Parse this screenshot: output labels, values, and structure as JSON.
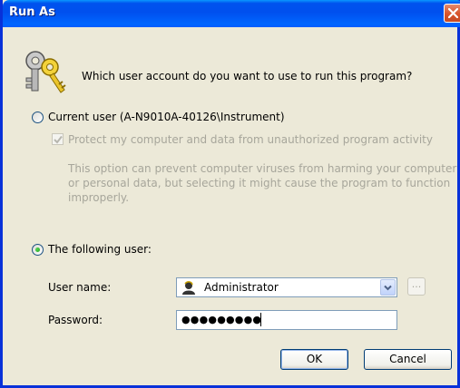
{
  "window": {
    "title": "Run As"
  },
  "prompt": "Which user account do you want to use to run this program?",
  "current_user": {
    "label": "Current user (A-N9010A-40126\\Instrument)",
    "selected": false,
    "protect_label": "Protect my computer and data from unauthorized program activity",
    "protect_checked": true,
    "description": "This option can prevent computer viruses from harming your computer or personal data, but selecting it might cause the program to function improperly."
  },
  "following_user": {
    "label": "The following user:",
    "selected": true,
    "username_label": "User name:",
    "username_value": "Administrator",
    "browse_label": "...",
    "password_label": "Password:",
    "password_value": "●●●●●●●●●"
  },
  "buttons": {
    "ok": "OK",
    "cancel": "Cancel"
  },
  "colors": {
    "titlebar": "#0054E3",
    "dialog_bg": "#ECE9D8",
    "close_button": "#D8532A",
    "radio_selected": "#21A121",
    "disabled_text": "#A7A69B"
  },
  "icons": [
    "keys-icon",
    "close-icon",
    "checkmark-icon",
    "user-icon",
    "chevron-down-icon"
  ]
}
